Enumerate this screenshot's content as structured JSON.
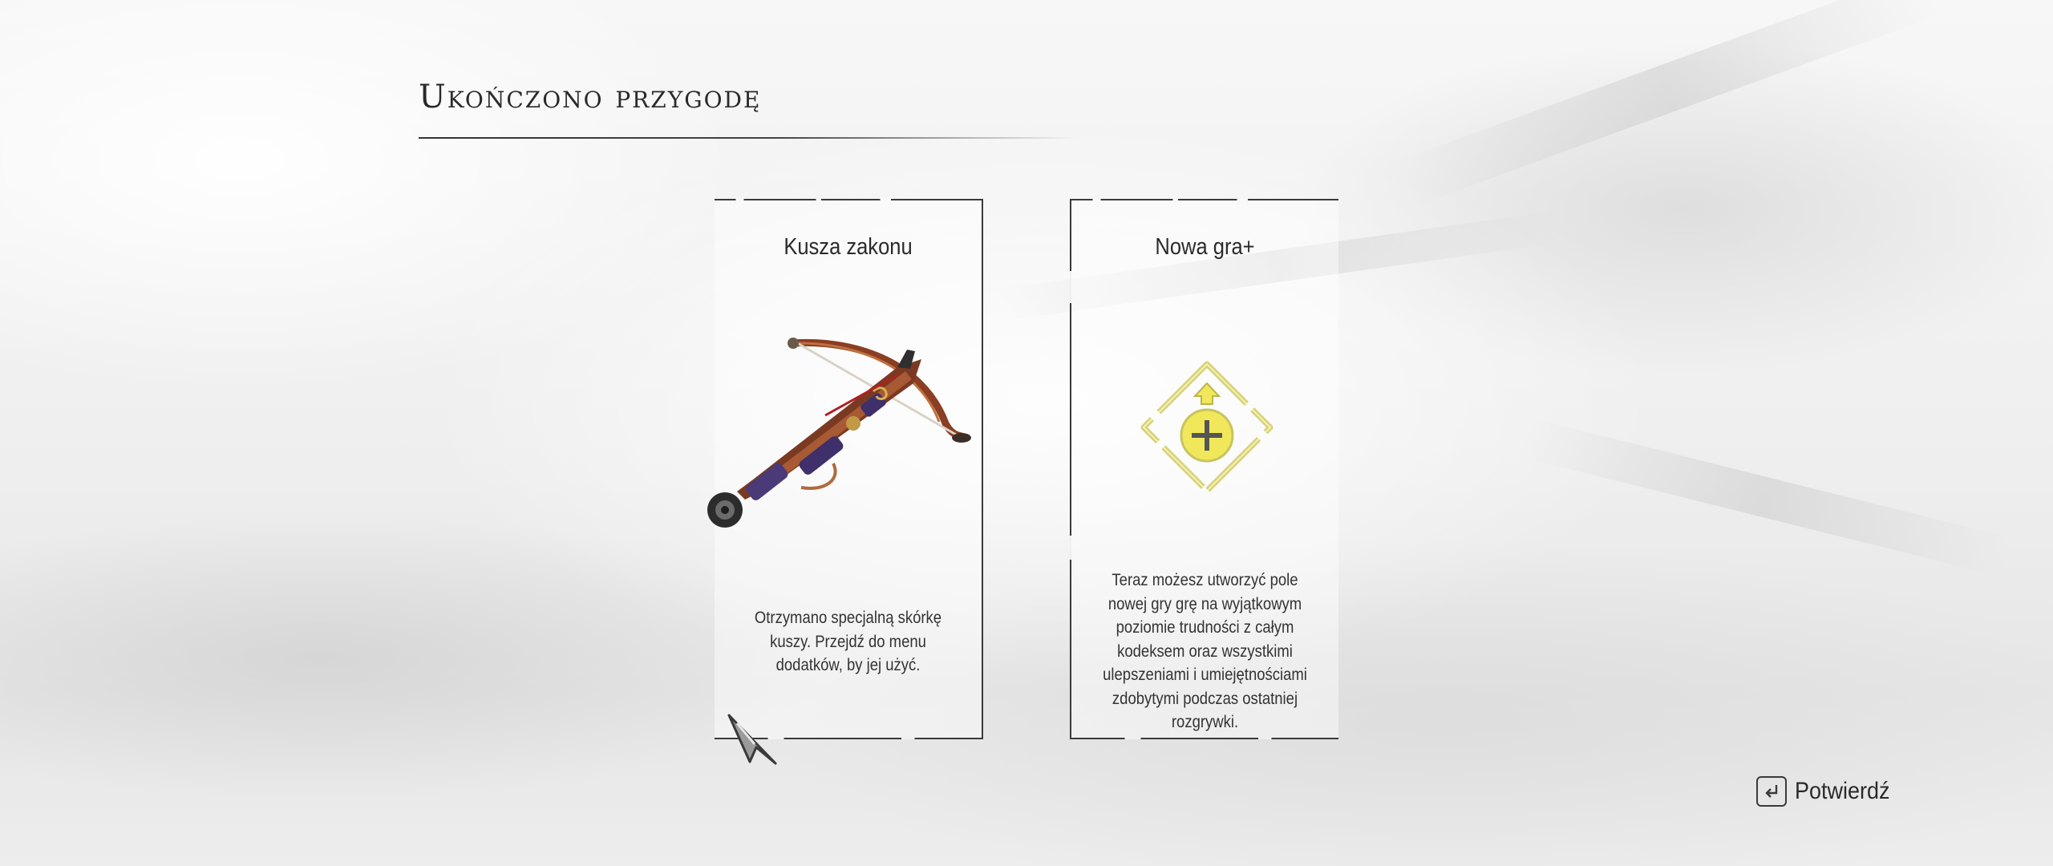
{
  "page": {
    "title": "Ukończono przygodę"
  },
  "cards": [
    {
      "title": "Kusza zakonu",
      "image_icon": "crossbow-icon",
      "description": "Otrzymano specjalną skórkę kuszy. Przejdź do menu dodatków, by jej użyć."
    },
    {
      "title": "Nowa gra+",
      "image_icon": "new-game-plus-icon",
      "description": "Teraz możesz utworzyć pole nowej gry grę na wyjątkowym poziomie trudności z całym kodeksem oraz wszystkimi ulepszeniami i umiejętnościami zdobytymi podczas ostatniej rozgrywki."
    }
  ],
  "prompt": {
    "key_icon": "enter-key-icon",
    "label": "Potwierdź"
  },
  "colors": {
    "text": "#2a2a2a",
    "emblem": "#f0e85a",
    "emblem_outline": "#d8d47a",
    "background": "#f3f3f3"
  }
}
